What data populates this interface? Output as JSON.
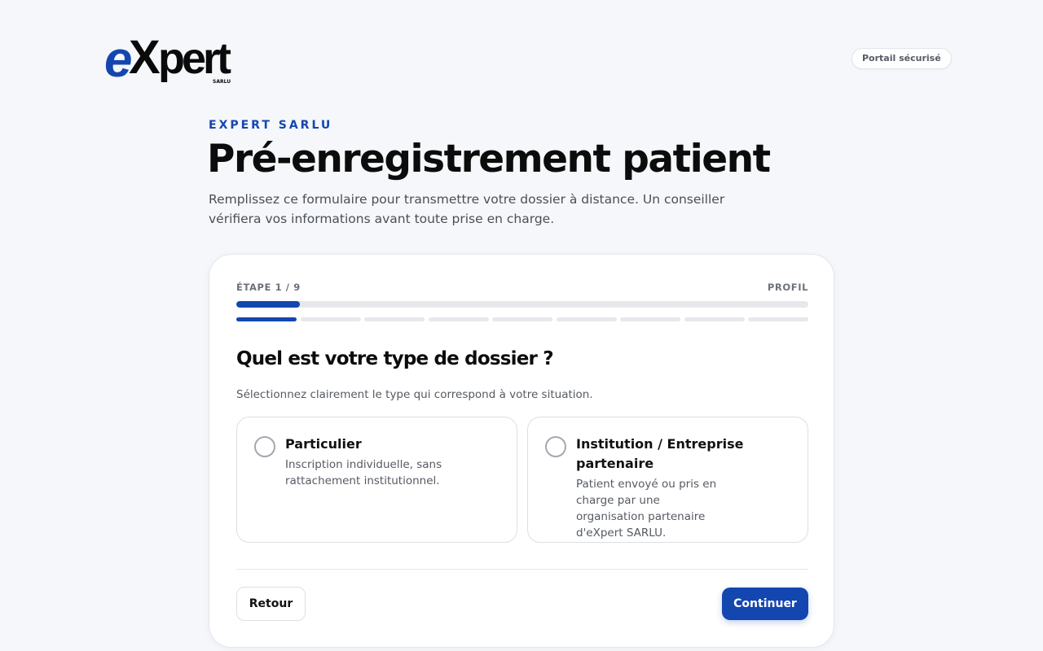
{
  "brand": {
    "logo_text": "eXpert",
    "logo_subtext": "SARLU",
    "secure_badge": "Portail sécurisé",
    "accent": "#1446b0"
  },
  "hero": {
    "eyebrow": "EXPERT SARLU",
    "title": "Pré-enregistrement patient",
    "description": "Remplissez ce formulaire pour transmettre votre dossier à distance. Un conseiller vérifiera vos informations avant toute prise en charge."
  },
  "form": {
    "step_label": "ÉTAPE 1 / 9",
    "step_name": "PROFIL",
    "current_step": 1,
    "total_steps": 9,
    "progress_fraction": 0.111,
    "question": "Quel est votre type de dossier ?",
    "hint": "Sélectionnez clairement le type qui correspond à votre situation.",
    "options": [
      {
        "title": "Particulier",
        "description": "Inscription individuelle, sans rattachement institutionnel.",
        "selected": false
      },
      {
        "title": "Institution / Entreprise partenaire",
        "description": "Patient envoyé ou pris en charge par une organisation partenaire d'eXpert SARLU.",
        "selected": false
      }
    ],
    "back_label": "Retour",
    "continue_label": "Continuer"
  }
}
